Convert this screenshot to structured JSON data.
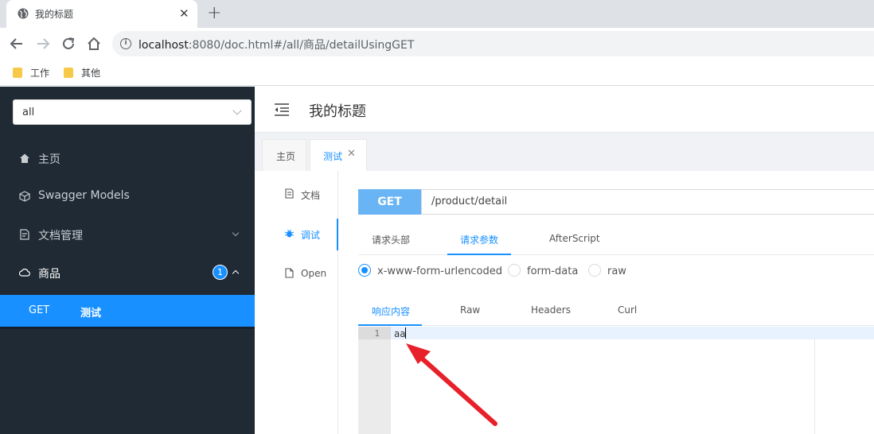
{
  "browser": {
    "tab_title": "我的标题",
    "tab_close": "✕",
    "new_tab": "+",
    "url_host": "localhost",
    "url_rest": ":8080/doc.html#/all/商品/detailUsingGET",
    "info_icon": "i"
  },
  "bookmarks": [
    {
      "label": "工作"
    },
    {
      "label": "其他"
    }
  ],
  "sidebar": {
    "group_select": "all",
    "items": [
      {
        "label": "主页",
        "icon": "home-icon"
      },
      {
        "label": "Swagger Models",
        "icon": "cube-icon"
      },
      {
        "label": "文档管理",
        "icon": "document-icon"
      },
      {
        "label": "商品",
        "icon": "cloud-icon",
        "badge": "1"
      }
    ],
    "sub_item": {
      "method": "GET",
      "name": "测试"
    }
  },
  "header": {
    "title": "我的标题"
  },
  "page_tabs": [
    {
      "label": "主页"
    },
    {
      "label": "测试",
      "close": "✕"
    }
  ],
  "left_menu": [
    {
      "label": "文档",
      "icon": "document-icon"
    },
    {
      "label": "调试",
      "icon": "bug-icon"
    },
    {
      "label": "Open",
      "icon": "file-icon"
    }
  ],
  "request": {
    "method": "GET",
    "path": "/product/detail"
  },
  "request_tabs": [
    "请求头部",
    "请求参数",
    "AfterScript"
  ],
  "request_tab_active": "请求参数",
  "body_types": [
    "x-www-form-urlencoded",
    "form-data",
    "raw"
  ],
  "body_type_selected": "x-www-form-urlencoded",
  "response_tabs": [
    "响应内容",
    "Raw",
    "Headers",
    "Curl"
  ],
  "response_tab_active": "响应内容",
  "editor": {
    "line_number": "1",
    "content": "aa"
  },
  "colors": {
    "accent": "#1890ff",
    "sidebar_bg": "#1f2a35",
    "method_get": "#69b4f5",
    "annotation_arrow": "#e8202a"
  }
}
